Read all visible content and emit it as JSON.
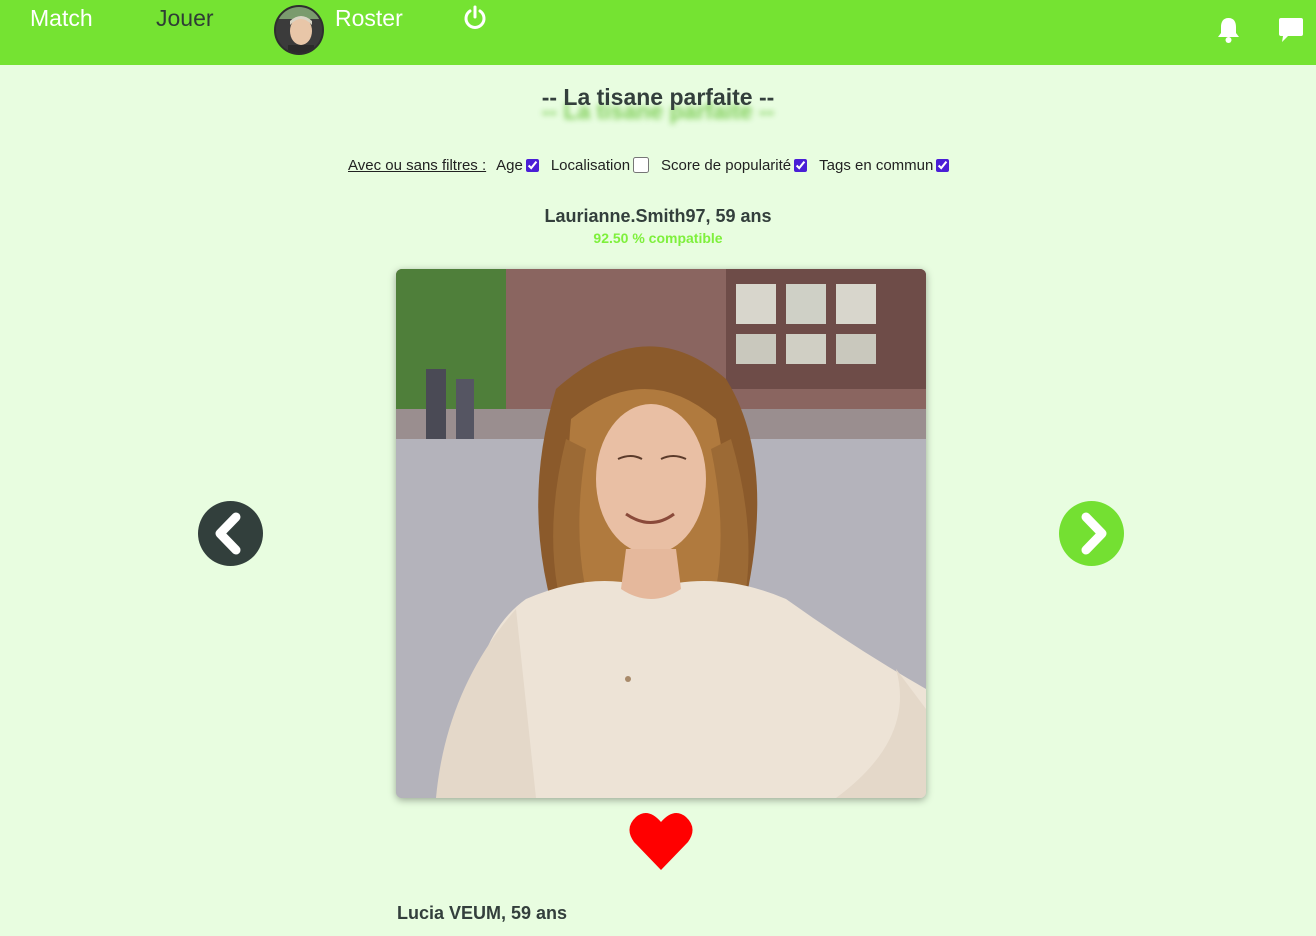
{
  "nav": {
    "match_label": "Match",
    "jouer_label": "Jouer",
    "roster_label": "Roster",
    "power_icon": "power-icon",
    "bell_icon": "bell-icon",
    "chat_icon": "chat-icon"
  },
  "page": {
    "title": "-- La tisane parfaite --"
  },
  "filters": {
    "label": "Avec ou sans filtres :",
    "items": [
      {
        "label": "Age",
        "checked": true
      },
      {
        "label": "Localisation",
        "checked": false
      },
      {
        "label": "Score de popularité",
        "checked": true
      },
      {
        "label": "Tags en commun",
        "checked": true
      }
    ]
  },
  "profile": {
    "name_age": "Laurianne.Smith97, 59 ans",
    "compatibility": "92.50 % compatible"
  },
  "next_profile": {
    "name_age": "Lucia VEUM, 59 ans"
  },
  "colors": {
    "navbar": "#75e332",
    "background": "#e8fde0",
    "dark": "#323f3c",
    "accent_green": "#74e032",
    "compat_text": "#7ef03c",
    "heart": "#ff0000",
    "checkbox": "#4a1fd6"
  }
}
